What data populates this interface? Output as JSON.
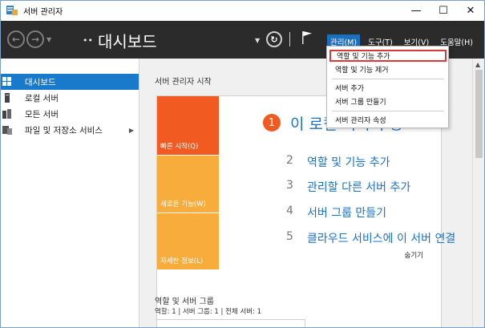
{
  "window": {
    "title": "서버 관리자",
    "controls": [
      "—",
      "☐",
      "✕"
    ]
  },
  "navbar": {
    "back_icon": "back-arrow-icon",
    "forward_icon": "forward-arrow-icon",
    "breadcrumb_chevron": "••",
    "page_title": "대시보드",
    "menu": [
      {
        "label": "관리(M)",
        "active": true
      },
      {
        "label": "도구(T)",
        "active": false
      },
      {
        "label": "보기(V)",
        "active": false
      },
      {
        "label": "도움말(H)",
        "active": false
      }
    ]
  },
  "sidebar": {
    "items": [
      {
        "label": "대시보드",
        "icon": "dashboard-icon",
        "selected": true
      },
      {
        "label": "로컬 서버",
        "icon": "server-icon",
        "selected": false
      },
      {
        "label": "모든 서버",
        "icon": "servers-icon",
        "selected": false
      },
      {
        "label": "파일 및 저장소 서비스",
        "icon": "storage-icon",
        "selected": false,
        "has_arrow": true
      }
    ]
  },
  "main": {
    "section_title": "서버 관리자 시작",
    "tiles": [
      "빠른 시작(Q)",
      "새로운 기능(W)",
      "자세한 정보(L)"
    ],
    "step1": {
      "num": "1",
      "text": "이 로컬 서버 구성"
    },
    "steps": [
      {
        "num": "2",
        "text": "역할 및 기능 추가"
      },
      {
        "num": "3",
        "text": "관리할 다른 서버 추가"
      },
      {
        "num": "4",
        "text": "서버 그룹 만들기"
      },
      {
        "num": "5",
        "text": "클라우드 서비스에 이 서버 연결"
      }
    ],
    "hide_label": "숨기기",
    "roles_title": "역할 및 서버 그룹",
    "roles_counts": "역할: 1   |   서버 그룹: 1   |   전체 서버: 1"
  },
  "dropdown": {
    "items": [
      {
        "label": "역할 및 기능 추가",
        "highlighted": true
      },
      {
        "label": "역할 및 기능 제거",
        "highlighted": false
      },
      {
        "label": "서버 추가",
        "highlighted": false
      },
      {
        "label": "서버 그룹 만들기",
        "highlighted": false
      },
      {
        "label": "서버 관리자 속성",
        "highlighted": false
      }
    ]
  },
  "colors": {
    "accent": "#1979ca",
    "tile_orange": "#f15b22",
    "tile_yellow": "#f8ac3c",
    "highlight_border": "#d83a3a"
  }
}
